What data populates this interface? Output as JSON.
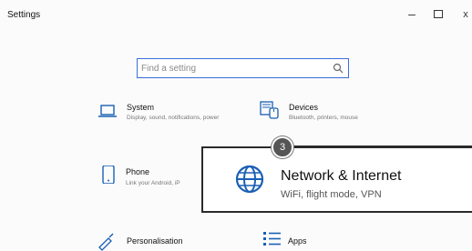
{
  "window": {
    "title": "Settings",
    "controls": {
      "minimize": "–",
      "close": "x"
    }
  },
  "search": {
    "placeholder": "Find a setting"
  },
  "tiles": [
    {
      "id": "system",
      "label": "System",
      "description": "Display, sound, notifications, power",
      "icon": "laptop-icon"
    },
    {
      "id": "devices",
      "label": "Devices",
      "description": "Bluetooth, printers, mouse",
      "icon": "devices-icon"
    },
    {
      "id": "phone",
      "label": "Phone",
      "description": "Link your Android, iP",
      "icon": "phone-icon"
    },
    {
      "id": "personalisation",
      "label": "Personalisation",
      "icon": "personalisation-icon"
    },
    {
      "id": "apps",
      "label": "Apps",
      "icon": "apps-icon"
    }
  ],
  "highlight": {
    "label": "Network & Internet",
    "description": "WiFi, flight mode, VPN",
    "icon": "globe-icon",
    "badge": "3"
  },
  "colors": {
    "accent": "#0078d7",
    "search_border": "#3a6fd8",
    "callout_border": "#2a2a2a"
  }
}
